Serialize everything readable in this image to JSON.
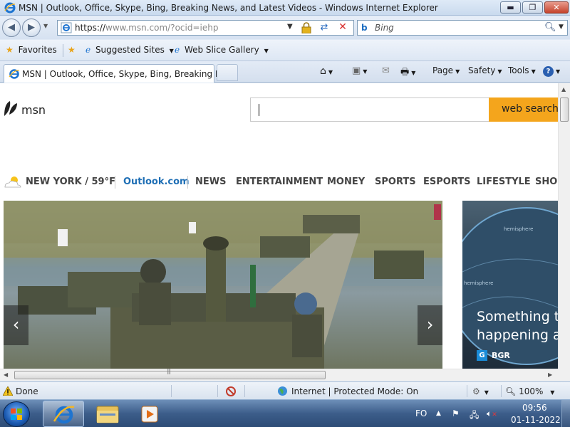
{
  "window": {
    "title": "MSN | Outlook, Office, Skype, Bing, Breaking News, and Latest Videos - Windows Internet Explorer",
    "min_label": "▬",
    "max_label": "❐",
    "close_label": "✕"
  },
  "addressbar": {
    "url_scheme": "https://",
    "url_host": "www.msn.com",
    "url_path": "/?ocid=iehp"
  },
  "searchbar": {
    "placeholder": "Bing"
  },
  "favorites_bar": {
    "favorites_label": "Favorites",
    "suggested_sites_label": "Suggested Sites",
    "web_slice_label": "Web Slice Gallery"
  },
  "tab": {
    "label": "MSN | Outlook, Office, Skype, Bing, Breaking Ne..."
  },
  "command_bar": {
    "page_label": "Page",
    "safety_label": "Safety",
    "tools_label": "Tools"
  },
  "page": {
    "logo_text": "msn",
    "search_button_label": "web search",
    "weather_label": "NEW YORK / 59°F",
    "nav": [
      "Outlook.com",
      "NEWS",
      "ENTERTAINMENT",
      "MONEY",
      "SPORTS",
      "ESPORTS",
      "LIFESTYLE",
      "SHOP"
    ],
    "side_headline_1": "Something te",
    "side_headline_2": "happening at",
    "side_source": "BGR",
    "side_source_badge": "G",
    "map_label_1": "hemisphere",
    "map_label_2": "hemisphere"
  },
  "statusbar": {
    "status": "Done",
    "zone": "Internet | Protected Mode: On",
    "zoom": "100%"
  },
  "taskbar": {
    "language": "FO",
    "time": "09:56",
    "date": "01-11-2022"
  },
  "colors": {
    "accent": "#f4a51c",
    "outlook_link": "#1f6fb5",
    "ie_blue": "#1f6fc2"
  }
}
